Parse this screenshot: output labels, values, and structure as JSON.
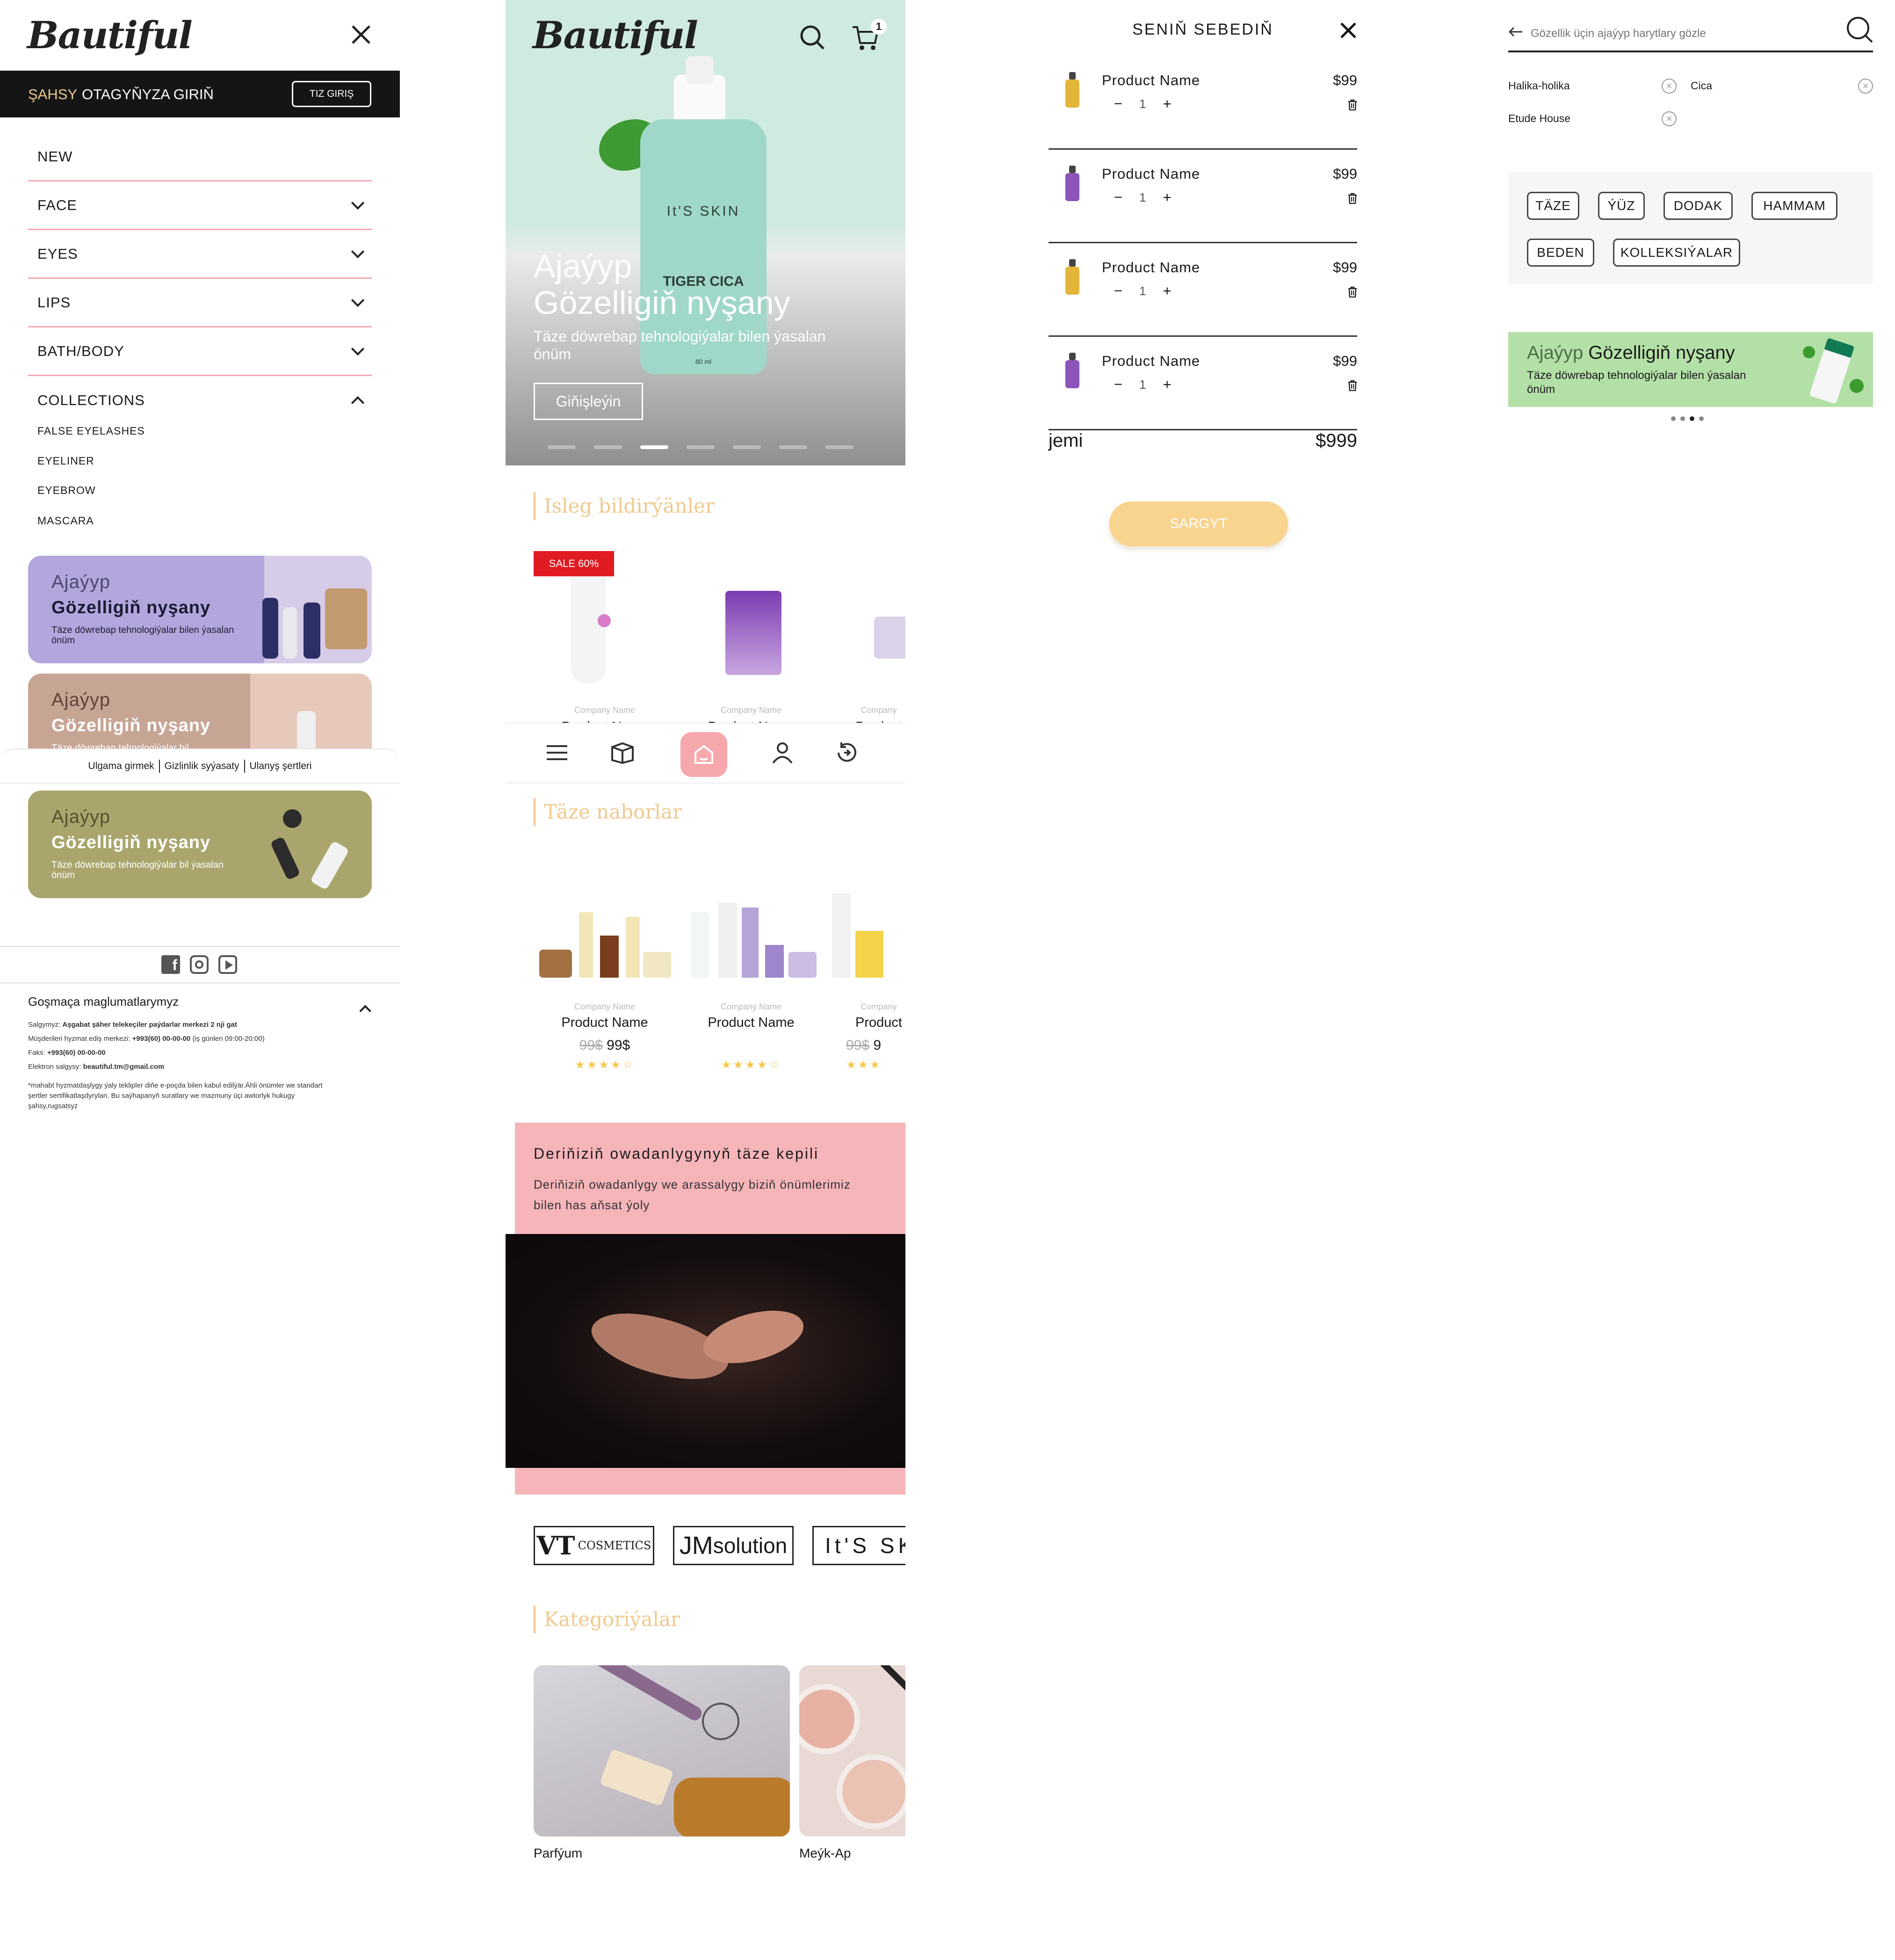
{
  "menu_panel": {
    "logo": "Bautiful",
    "login_banner": {
      "prefix": "ŞAHSY",
      "text": "OTAGYŇYZA GIRIŇ",
      "button": "TIZ GIRIŞ"
    },
    "items": [
      {
        "label": "NEW"
      },
      {
        "label": "FACE"
      },
      {
        "label": "EYES"
      },
      {
        "label": "LIPS"
      },
      {
        "label": "BATH/BODY"
      },
      {
        "label": "COLLECTIONS"
      }
    ],
    "sub_items": [
      "FALSE EYELASHES",
      "EYELINER",
      "EYEBROW",
      "MASCARA"
    ],
    "promos": [
      {
        "line1": "Ajaýyp",
        "line2": "Gözelligiň nyşany",
        "line3": "Täze döwrebap tehnologiýalar bilen ýasalan önüm",
        "bg": "#b3a6dd"
      },
      {
        "line1": "Ajaýyp",
        "line2": "Gözelligiň nyşany",
        "line3": "Täze döwrebap tehnologiýalar bil",
        "bg": "#c7a595"
      },
      {
        "line1": "Ajaýyp",
        "line2": "Gözelligiň nyşany",
        "line3": "Täze döwrebap tehnologiýalar bil ýasalan önüm",
        "bg": "#aaa56d"
      }
    ],
    "footer_links": [
      "Ulgama girmek",
      "Gizlinlik syýasaty",
      "Ulanyş şertleri"
    ],
    "extra_info": {
      "title": "Goşmaça maglumatlarymyz",
      "lines": [
        {
          "label": "Salgymyz:",
          "value": "Aşgabat şäher telekeçiler paýdarlar merkezi 2 nji gat"
        },
        {
          "label": "Müşderileri hyzmat ediş merkezi:",
          "value": "+993(60) 00-00-00",
          "note": "(iş günleri 09:00-20:00)"
        },
        {
          "label": "Faks:",
          "value": "+993(60) 00-00-00"
        },
        {
          "label": "Elektron salgysy:",
          "value": "beautiful.tm@gmail.com"
        }
      ],
      "disclaimer": "*mahabt hyzmatdaşlygy ýaly teklipler diňe e-poçda bilen kabul edilýär.Ähli önümler we standart şertler sertifikatlaşdyrylan. Bu saýhapanyň suratlary we mazmuny üçi awtorlyk hukugy şahsy,rugsatsyz"
    }
  },
  "home_panel": {
    "logo": "Bautiful",
    "cart_count": "1",
    "hero": {
      "title_line1": "Ajaýyp",
      "title_line2": "Gözelligiň nyşany",
      "subtitle": "Täze döwrebap tehnologiýalar bilen ýasalan önüm",
      "button": "Giňişleýin",
      "product_brand": "It'S SKIN",
      "product_name": "TIGER CICA",
      "product_volume": "80 ml",
      "slides": 7,
      "active_slide": 3
    },
    "sections": {
      "bestsellers": "Isleg bildirýänler",
      "new_sets": "Täze naborlar",
      "categories": "Kategoriýalar"
    },
    "sale_badge": "SALE 60%",
    "bestsellers": [
      {
        "company": "Company Name",
        "name": "Product Name"
      },
      {
        "company": "Company Name",
        "name": "Product Name"
      },
      {
        "company": "Company",
        "name": "Product"
      }
    ],
    "new_sets": [
      {
        "company": "Company Name",
        "name": "Product Name",
        "old_price": "99$",
        "price": "99$",
        "rating": 4.5
      },
      {
        "company": "Company Name",
        "name": "Product Name",
        "old_price": "",
        "price": "",
        "rating": 4.5
      },
      {
        "company": "Company",
        "name": "Product",
        "old_price": "99$",
        "price": "9",
        "rating": 3
      }
    ],
    "skin_banner": {
      "title": "Deriňiziň owadanlygynyň täze kepili",
      "text": "Deriňiziň owadanlygy we arassalygy biziň önümlerimiz bilen has aňsat ýoly"
    },
    "brands": [
      {
        "main": "VT",
        "sub": "COSMETICS"
      },
      {
        "main": "JM",
        "sub": "solution"
      },
      {
        "main": "It'S SKI",
        "sub": ""
      }
    ],
    "categories": [
      {
        "label": "Parfýum"
      },
      {
        "label": "Meýk-Ap"
      }
    ],
    "colors": {
      "accent": "#f1c98d",
      "pink": "#f6b5b9",
      "sale": "#e01b22",
      "hero_bg": "#cfeadf"
    }
  },
  "cart_panel": {
    "title": "SENIŇ SEBEDIŇ",
    "items": [
      {
        "name": "Product Name",
        "price": "$99",
        "qty": "1",
        "color": "#e3b53a"
      },
      {
        "name": "Product Name",
        "price": "$99",
        "qty": "1",
        "color": "#8b55b9"
      },
      {
        "name": "Product Name",
        "price": "$99",
        "qty": "1",
        "color": "#e3b53a"
      },
      {
        "name": "Product Name",
        "price": "$99",
        "qty": "1",
        "color": "#8b55b9"
      }
    ],
    "total_label": "jemi",
    "total_value": "$999",
    "checkout": "SARGYT"
  },
  "search_panel": {
    "placeholder": "Gözellik üçin ajaýyp harytlary gözle",
    "recent": [
      "Halika-holika",
      "Cica",
      "Etude House"
    ],
    "chips": [
      "TÄZE",
      "ÝÜZ",
      "DODAK",
      "HAMMAM",
      "BEDEN",
      "KOLLEKSIÝALAR"
    ],
    "banner": {
      "accent": "Ajaýyp",
      "title": "Gözelligiň nyşany",
      "text": "Täze döwrebap tehnologiýalar bilen ýasalan önüm"
    },
    "dots": 4,
    "active_dot": 3
  }
}
